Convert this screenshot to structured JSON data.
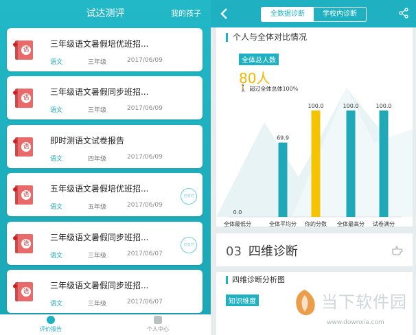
{
  "left": {
    "title": "试达测评",
    "children_link": "我的孩子",
    "reports": [
      {
        "title": "三年级语文暑假培优班招...",
        "subject": "语文",
        "grade": "三年级",
        "date": "2017/06/09",
        "stamp": ""
      },
      {
        "title": "三年级语文暑假同步班招...",
        "subject": "语文",
        "grade": "三年级",
        "date": "2017/06/09",
        "stamp": ""
      },
      {
        "title": "即时测语文试卷报告",
        "subject": "语文",
        "grade": "四年级",
        "date": "2017/06/09",
        "stamp": ""
      },
      {
        "title": "五年级语文暑假培优班招...",
        "subject": "语文",
        "grade": "五年级",
        "date": "2017/06/09",
        "stamp": "已支付"
      },
      {
        "title": "三年级语文暑假同步班招...",
        "subject": "语文",
        "grade": "三年级",
        "date": "2017/06/07",
        "stamp": "已支付"
      },
      {
        "title": "三年级语文暑假同步班招...",
        "subject": "语文",
        "grade": "三年级",
        "date": "2017/06/07",
        "stamp": ""
      }
    ],
    "book_glyph": "语",
    "nav": {
      "report_label": "评价报告",
      "profile_label": "个人中心"
    }
  },
  "right": {
    "tabs": [
      "全数据诊断",
      "学校内诊断"
    ],
    "compare_heading": "个人与全体对比情况",
    "total_badge": "全体总人数",
    "total_value": "80人",
    "exceed_text": "超过全体总体100%",
    "diag_number": "03",
    "diag_title": "四维诊断",
    "diag_subheading": "四维诊断分析图",
    "knowledge_badge": "知识维度"
  },
  "watermark": {
    "text": "当下软件园",
    "url": "www.downxia.com"
  },
  "colors": {
    "teal": "#1fb1c2",
    "bar": "#1ea8b8",
    "highlight": "#f5c400",
    "book": "#e96a6a"
  },
  "chart_data": {
    "type": "bar",
    "categories": [
      "全体最低分",
      "全体平均分",
      "你的分数",
      "全体最高分",
      "试卷满分"
    ],
    "values": [
      0.0,
      69.9,
      100.0,
      100.0,
      100.0
    ],
    "value_labels": [
      "0.0",
      "69.9",
      "100.0",
      "100.0",
      "100.0"
    ],
    "highlight_index": 2,
    "ylim": [
      0,
      100
    ]
  }
}
